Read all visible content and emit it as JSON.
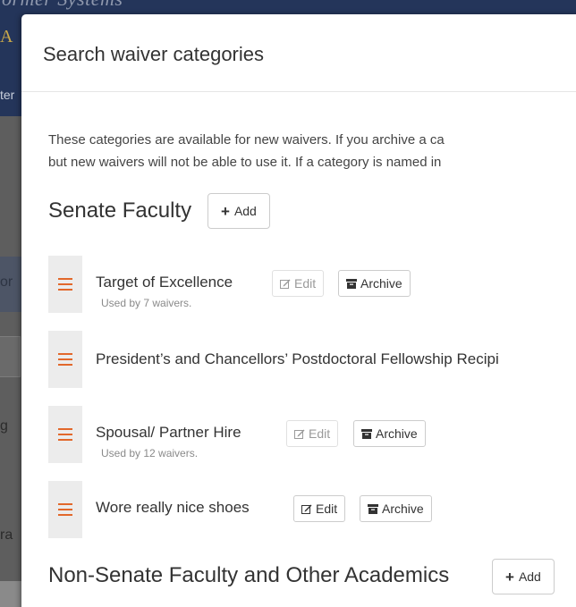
{
  "background": {
    "header_title": "ormer Systems",
    "logo_letter": "A",
    "nav_fragment": "ter",
    "band_fragment": "or",
    "fragment_g": "g",
    "fragment_ra": "ra"
  },
  "modal": {
    "title": "Search waiver categories",
    "intro_line_1": "These categories are available for new waivers. If you archive a ca",
    "intro_line_2": "but new waivers will not be able to use it. If a category is named in"
  },
  "sections": [
    {
      "heading": "Senate Faculty",
      "add_label": "Add",
      "categories": [
        {
          "name": "Target of Excellence",
          "meta": "Used by 7 waivers.",
          "edit_label": "Edit",
          "archive_label": "Archive",
          "edit_enabled": false
        },
        {
          "name": "President’s and Chancellors’ Postdoctoral Fellowship Recipi",
          "meta": "",
          "edit_label": "",
          "archive_label": "",
          "edit_enabled": false
        },
        {
          "name": "Spousal/ Partner Hire",
          "meta": "Used by 12 waivers.",
          "edit_label": "Edit",
          "archive_label": "Archive",
          "edit_enabled": false
        },
        {
          "name": "Wore really nice shoes",
          "meta": "",
          "edit_label": "Edit",
          "archive_label": "Archive",
          "edit_enabled": true
        }
      ]
    },
    {
      "heading": "Non-Senate Faculty and Other Academics",
      "add_label": "Add"
    }
  ],
  "colors": {
    "handle_icon": "#e2682b",
    "modal_bg": "#ffffff",
    "backdrop": "#5e5e5e",
    "header_bg": "#24355a"
  }
}
